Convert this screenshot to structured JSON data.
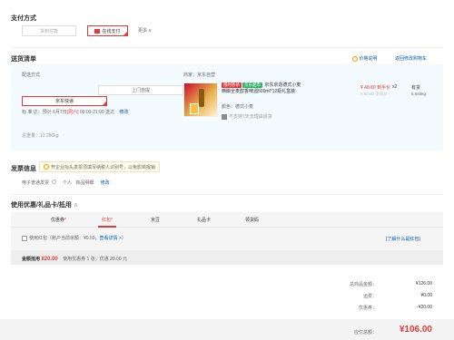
{
  "payment": {
    "title": "支付方式",
    "options": [
      "货到付款",
      "在线支付"
    ],
    "more": "更多 ∨"
  },
  "shipping": {
    "title": "送货清单",
    "price_note": "价格说明",
    "back_cart": "返回修改购物车",
    "delivery_label": "配送方式",
    "delivery_options": [
      "京东快递",
      "上门自提"
    ],
    "time_label": "标 准 达：",
    "time_prefix": "预计 6月7日",
    "time_day": "[周六]",
    "time_range": " 09:00-21:00 送达",
    "time_modify": "修改",
    "weight": "总重量：13.280kg",
    "merchant": "商家：京东自营",
    "product": {
      "tags": [
        "限时秒杀",
        "京东超市"
      ],
      "name_line1": "京东京造德式小麦",
      "name_line2": "精酿全麦醇香啤酒500ml*12瓶礼盒装",
      "price": "¥ 48.80 到手价",
      "orig_price": "¥ 63.80 京东价",
      "qty": "x2",
      "stock": "有货",
      "weight": "6.640kg",
      "color_label": "颜色：",
      "color_value": "德式小麦",
      "return_policy": "不支持7天无理由退货"
    }
  },
  "invoice": {
    "title": "发票信息",
    "notice": "开企业抬头发票须填写纳税人识别号，以免影响报销",
    "type": "电子普通发票",
    "person": "个人",
    "detail": "商品明细",
    "modify": "修改"
  },
  "coupons": {
    "title": "使用优惠/礼品卡/抵用",
    "tabs": [
      "优惠券",
      "红包",
      "京豆",
      "礼品卡",
      "领货码"
    ],
    "redpacket_check": "使用红包（账户当前余额：¥0.59，",
    "redpacket_link": "查看详情 >",
    "redpacket_close": "）",
    "learn_more": "[了解什么是红包]",
    "summary_label": "金额抵用",
    "summary_amount": "¥20.00",
    "summary_detail": "使用优惠券 1 张，优惠 20.00 元"
  },
  "totals": {
    "items_label": "总商品金额：",
    "items_value": "¥126.00",
    "shipping_label": "运费：",
    "shipping_value": "¥0.00",
    "discount_label": "优惠券：",
    "discount_value": "-¥20.00",
    "pay_label": "应付总额：",
    "pay_value": "¥106.00"
  }
}
